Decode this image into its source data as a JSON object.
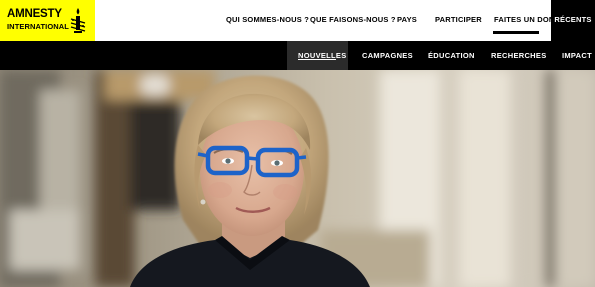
{
  "logo": {
    "line1": "AMNESTY",
    "line2": "INTERNATIONAL",
    "icon": "candle-barbed-wire-icon",
    "bg_color": "#ffff00"
  },
  "top_nav": {
    "items": [
      {
        "label": "QUI SOMMES-NOUS ?"
      },
      {
        "label": "QUE FAISONS-NOUS ?"
      },
      {
        "label": "PAYS"
      },
      {
        "label": "PARTICIPER"
      },
      {
        "label": "FAITES UN DON"
      }
    ],
    "recents": "RÉCENTS"
  },
  "sub_nav": {
    "items": [
      {
        "label": "NOUVELLES",
        "active": true
      },
      {
        "label": "CAMPAGNES"
      },
      {
        "label": "ÉDUCATION"
      },
      {
        "label": "RECHERCHES"
      },
      {
        "label": "IMPACT"
      }
    ]
  },
  "hero": {
    "glasses_color": "#1d63c9"
  }
}
